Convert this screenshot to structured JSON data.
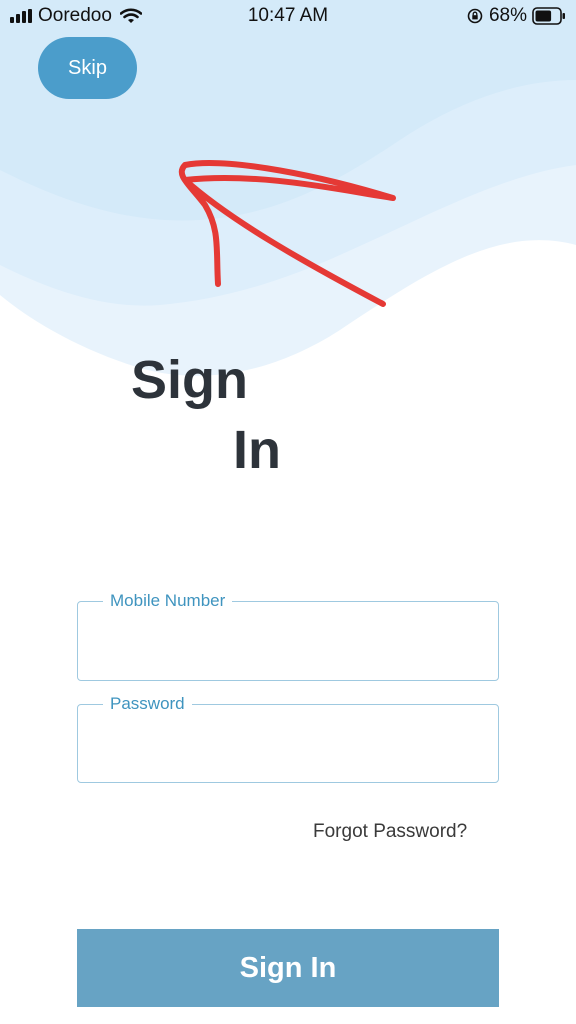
{
  "status_bar": {
    "carrier": "Ooredoo",
    "time": "10:47 AM",
    "battery_percent": "68%",
    "battery_level": 0.68,
    "icons": [
      "signal-icon",
      "wifi-icon",
      "rotation-lock-icon",
      "battery-icon"
    ]
  },
  "header": {
    "skip_label": "Skip"
  },
  "title": {
    "line1": "Sign",
    "line2": "In"
  },
  "form": {
    "mobile_label": "Mobile Number",
    "mobile_value": "",
    "password_label": "Password",
    "password_value": "",
    "forgot_password": "Forgot Password?",
    "submit_label": "Sign In"
  },
  "colors": {
    "accent": "#4b9dcb",
    "button": "#67a3c4",
    "title": "#2d333a",
    "annotation": "#e53935",
    "wave_light": "#e8f3fc",
    "wave_mid": "#d9ecf9"
  }
}
